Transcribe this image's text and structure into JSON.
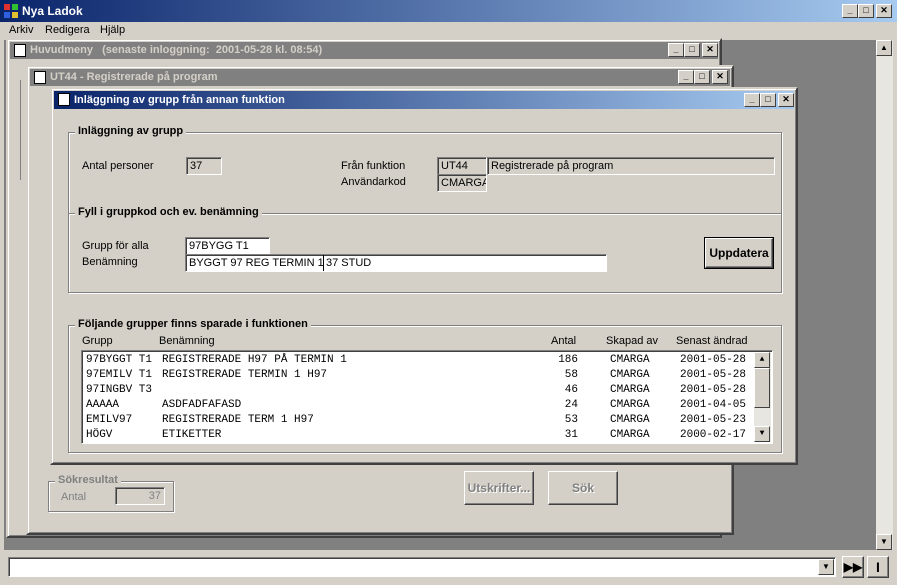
{
  "app": {
    "title": "Nya Ladok",
    "menu": [
      "Arkiv",
      "Redigera",
      "Hjälp"
    ]
  },
  "huvudmeny": {
    "title": "Huvudmeny   (senaste inloggning:  2001-05-28 kl. 08:54)"
  },
  "ut44": {
    "title": "UT44 - Registrerade på program",
    "sokresultat_title": "Sökresultat",
    "antal_label": "Antal",
    "antal_value": "37",
    "utskrifter_button": "Utskrifter...",
    "sok_button": "Sök"
  },
  "dialog": {
    "title": "Inläggning av grupp från annan funktion",
    "group1": {
      "title": "Inläggning av grupp",
      "antal_personer_label": "Antal personer",
      "antal_personer_value": "37",
      "fran_funktion_label": "Från funktion",
      "fran_funktion_code": "UT44",
      "fran_funktion_name": "Registrerade på program",
      "anvandarkod_label": "Användarkod",
      "anvandarkod_value": "CMARGA"
    },
    "group2": {
      "title": "Fyll i gruppkod och ev. benämning",
      "grupp_label": "Grupp för alla",
      "grupp_value": "97BYGG T1",
      "benamning_label": "Benämning",
      "benamning_value1": "BYGGT 97 REG TERMIN 1",
      "benamning_value2": "37 STUD",
      "uppdatera_button": "Uppdatera"
    },
    "group3": {
      "title": "Följande grupper finns sparade i funktionen",
      "columns": [
        "Grupp",
        "Benämning",
        "Antal",
        "Skapad av",
        "Senast ändrad"
      ],
      "rows": [
        {
          "grupp": "97BYGGT T1",
          "benamning": "REGISTRERADE H97 PÅ TERMIN 1",
          "antal": "186",
          "skapad": "CMARGA",
          "andrad": "2001-05-28"
        },
        {
          "grupp": "97EMILV T1",
          "benamning": "REGISTRERADE TERMIN 1 H97",
          "antal": "58",
          "skapad": "CMARGA",
          "andrad": "2001-05-28"
        },
        {
          "grupp": "97INGBV T3",
          "benamning": "",
          "antal": "46",
          "skapad": "CMARGA",
          "andrad": "2001-05-28"
        },
        {
          "grupp": "AAAAA",
          "benamning": "ASDFADFAFASD",
          "antal": "24",
          "skapad": "CMARGA",
          "andrad": "2001-04-05"
        },
        {
          "grupp": "EMILV97",
          "benamning": "REGISTRERADE TERM 1 H97",
          "antal": "53",
          "skapad": "CMARGA",
          "andrad": "2001-05-23"
        },
        {
          "grupp": "HÖGV",
          "benamning": "ETIKETTER",
          "antal": "31",
          "skapad": "CMARGA",
          "andrad": "2000-02-17"
        }
      ]
    }
  }
}
